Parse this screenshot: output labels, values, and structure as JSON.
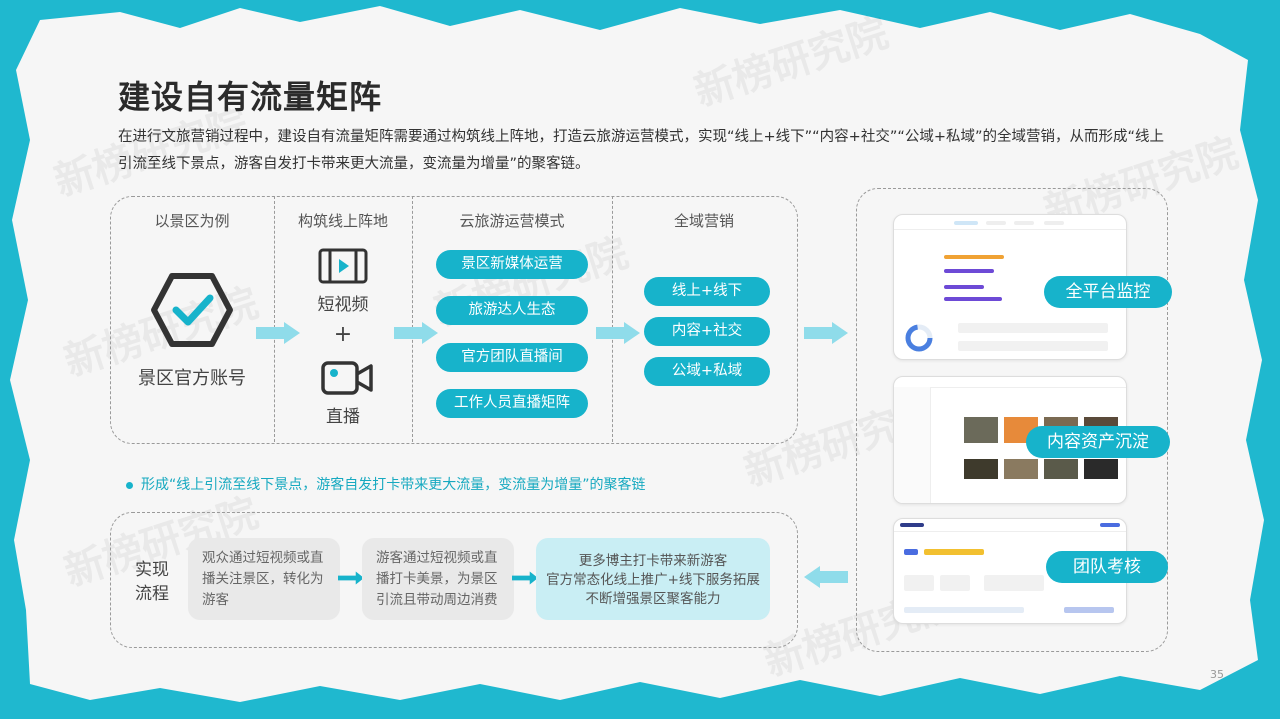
{
  "title": "建设自有流量矩阵",
  "intro": "在进行文旅营销过程中，建设自有流量矩阵需要通过构筑线上阵地，打造云旅游运营模式，实现“线上+线下”“内容+社交”“公域+私域”的全域营销，从而形成“线上引流至线下景点，游客自发打卡带来更大流量，变流量为增量”的聚客链。",
  "watermark": "新榜研究院",
  "columns": {
    "c1": "以景区为例",
    "c2": "构筑线上阵地",
    "c3": "云旅游运营模式",
    "c4": "全域营销"
  },
  "scenic_account": "景区官方账号",
  "short_video": "短视频",
  "plus": "+",
  "live": "直播",
  "ops_modes": [
    "景区新媒体运营",
    "旅游达人生态",
    "官方团队直播间",
    "工作人员直播矩阵"
  ],
  "marketing": [
    "线上+线下",
    "内容+社交",
    "公域+私域"
  ],
  "bullet": "形成“线上引流至线下景点，游客自发打卡带来更大流量，变流量为增量”的聚客链",
  "process_label_1": "实现",
  "process_label_2": "流程",
  "step1": "观众通过短视频或直播关注景区，转化为游客",
  "step2": "游客通过短视频或直播打卡美景，为景区引流且带动周边消费",
  "step3": [
    "更多博主打卡带来新游客",
    "官方常态化线上推广+线下服务拓展",
    "不断增强景区聚客能力"
  ],
  "tags": [
    "全平台监控",
    "内容资产沉淀",
    "团队考核"
  ],
  "page_number": "35",
  "colors": {
    "accent": "#17b3cb",
    "background": "#1fb8cf"
  }
}
